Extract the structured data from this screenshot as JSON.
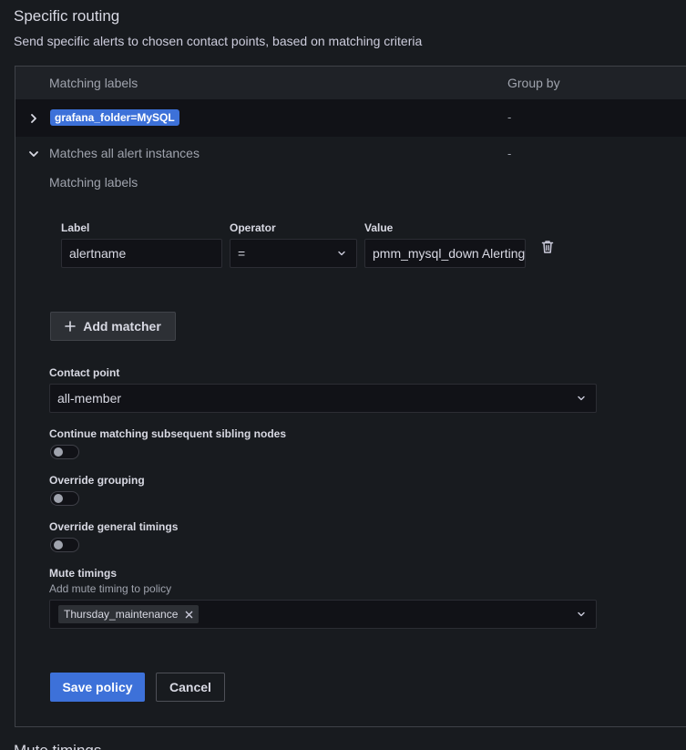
{
  "section": {
    "title": "Specific routing",
    "description": "Send specific alerts to chosen contact points, based on matching criteria"
  },
  "table": {
    "col_matching_labels": "Matching labels",
    "col_group_by": "Group by",
    "rows": [
      {
        "matcher": "grafana_folder=MySQL",
        "group_by": "-",
        "expanded": false
      },
      {
        "matcher": "Matches all alert instances",
        "group_by": "-",
        "expanded": true
      }
    ]
  },
  "editor": {
    "matching_labels_heading": "Matching labels",
    "label_header": "Label",
    "operator_header": "Operator",
    "value_header": "Value",
    "matcher": {
      "label": "alertname",
      "operator": "=",
      "value": "pmm_mysql_down Alerting"
    },
    "add_matcher_label": "Add matcher",
    "contact_point_label": "Contact point",
    "contact_point_value": "all-member",
    "continue_matching_label": "Continue matching subsequent sibling nodes",
    "override_grouping_label": "Override grouping",
    "override_timings_label": "Override general timings",
    "mute_timings_label": "Mute timings",
    "mute_timings_description": "Add mute timing to policy",
    "mute_timings_selected": [
      "Thursday_maintenance"
    ],
    "save_label": "Save policy",
    "cancel_label": "Cancel"
  },
  "next_section_title": "Mute timings",
  "colors": {
    "primary": "#3d71d9",
    "background": "#181b1f",
    "input_background": "#111217"
  },
  "icons": [
    "chevron-right-icon",
    "chevron-down-icon",
    "trash-icon",
    "plus-icon",
    "caret-down-icon",
    "close-icon"
  ]
}
